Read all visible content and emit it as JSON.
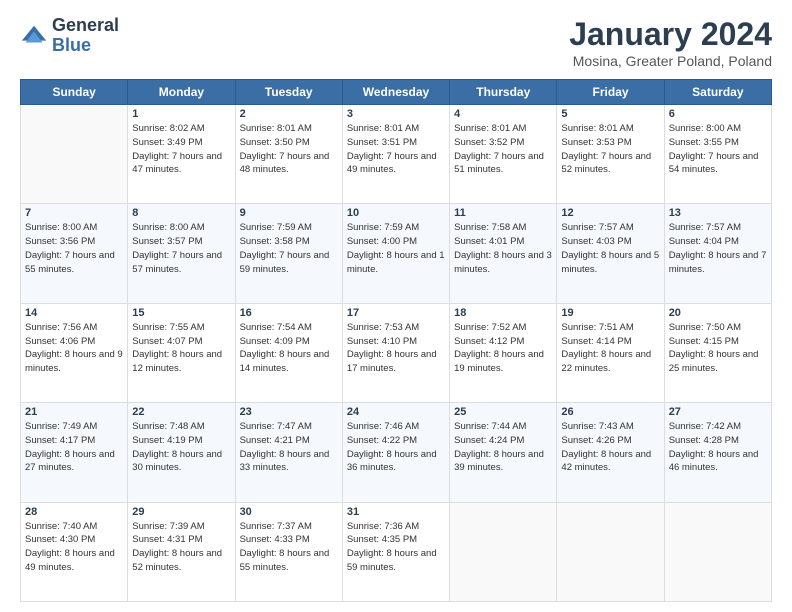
{
  "logo": {
    "general": "General",
    "blue": "Blue"
  },
  "title": "January 2024",
  "subtitle": "Mosina, Greater Poland, Poland",
  "weekdays": [
    "Sunday",
    "Monday",
    "Tuesday",
    "Wednesday",
    "Thursday",
    "Friday",
    "Saturday"
  ],
  "weeks": [
    [
      {
        "day": "",
        "sunrise": "",
        "sunset": "",
        "daylight": ""
      },
      {
        "day": "1",
        "sunrise": "Sunrise: 8:02 AM",
        "sunset": "Sunset: 3:49 PM",
        "daylight": "Daylight: 7 hours and 47 minutes."
      },
      {
        "day": "2",
        "sunrise": "Sunrise: 8:01 AM",
        "sunset": "Sunset: 3:50 PM",
        "daylight": "Daylight: 7 hours and 48 minutes."
      },
      {
        "day": "3",
        "sunrise": "Sunrise: 8:01 AM",
        "sunset": "Sunset: 3:51 PM",
        "daylight": "Daylight: 7 hours and 49 minutes."
      },
      {
        "day": "4",
        "sunrise": "Sunrise: 8:01 AM",
        "sunset": "Sunset: 3:52 PM",
        "daylight": "Daylight: 7 hours and 51 minutes."
      },
      {
        "day": "5",
        "sunrise": "Sunrise: 8:01 AM",
        "sunset": "Sunset: 3:53 PM",
        "daylight": "Daylight: 7 hours and 52 minutes."
      },
      {
        "day": "6",
        "sunrise": "Sunrise: 8:00 AM",
        "sunset": "Sunset: 3:55 PM",
        "daylight": "Daylight: 7 hours and 54 minutes."
      }
    ],
    [
      {
        "day": "7",
        "sunrise": "Sunrise: 8:00 AM",
        "sunset": "Sunset: 3:56 PM",
        "daylight": "Daylight: 7 hours and 55 minutes."
      },
      {
        "day": "8",
        "sunrise": "Sunrise: 8:00 AM",
        "sunset": "Sunset: 3:57 PM",
        "daylight": "Daylight: 7 hours and 57 minutes."
      },
      {
        "day": "9",
        "sunrise": "Sunrise: 7:59 AM",
        "sunset": "Sunset: 3:58 PM",
        "daylight": "Daylight: 7 hours and 59 minutes."
      },
      {
        "day": "10",
        "sunrise": "Sunrise: 7:59 AM",
        "sunset": "Sunset: 4:00 PM",
        "daylight": "Daylight: 8 hours and 1 minute."
      },
      {
        "day": "11",
        "sunrise": "Sunrise: 7:58 AM",
        "sunset": "Sunset: 4:01 PM",
        "daylight": "Daylight: 8 hours and 3 minutes."
      },
      {
        "day": "12",
        "sunrise": "Sunrise: 7:57 AM",
        "sunset": "Sunset: 4:03 PM",
        "daylight": "Daylight: 8 hours and 5 minutes."
      },
      {
        "day": "13",
        "sunrise": "Sunrise: 7:57 AM",
        "sunset": "Sunset: 4:04 PM",
        "daylight": "Daylight: 8 hours and 7 minutes."
      }
    ],
    [
      {
        "day": "14",
        "sunrise": "Sunrise: 7:56 AM",
        "sunset": "Sunset: 4:06 PM",
        "daylight": "Daylight: 8 hours and 9 minutes."
      },
      {
        "day": "15",
        "sunrise": "Sunrise: 7:55 AM",
        "sunset": "Sunset: 4:07 PM",
        "daylight": "Daylight: 8 hours and 12 minutes."
      },
      {
        "day": "16",
        "sunrise": "Sunrise: 7:54 AM",
        "sunset": "Sunset: 4:09 PM",
        "daylight": "Daylight: 8 hours and 14 minutes."
      },
      {
        "day": "17",
        "sunrise": "Sunrise: 7:53 AM",
        "sunset": "Sunset: 4:10 PM",
        "daylight": "Daylight: 8 hours and 17 minutes."
      },
      {
        "day": "18",
        "sunrise": "Sunrise: 7:52 AM",
        "sunset": "Sunset: 4:12 PM",
        "daylight": "Daylight: 8 hours and 19 minutes."
      },
      {
        "day": "19",
        "sunrise": "Sunrise: 7:51 AM",
        "sunset": "Sunset: 4:14 PM",
        "daylight": "Daylight: 8 hours and 22 minutes."
      },
      {
        "day": "20",
        "sunrise": "Sunrise: 7:50 AM",
        "sunset": "Sunset: 4:15 PM",
        "daylight": "Daylight: 8 hours and 25 minutes."
      }
    ],
    [
      {
        "day": "21",
        "sunrise": "Sunrise: 7:49 AM",
        "sunset": "Sunset: 4:17 PM",
        "daylight": "Daylight: 8 hours and 27 minutes."
      },
      {
        "day": "22",
        "sunrise": "Sunrise: 7:48 AM",
        "sunset": "Sunset: 4:19 PM",
        "daylight": "Daylight: 8 hours and 30 minutes."
      },
      {
        "day": "23",
        "sunrise": "Sunrise: 7:47 AM",
        "sunset": "Sunset: 4:21 PM",
        "daylight": "Daylight: 8 hours and 33 minutes."
      },
      {
        "day": "24",
        "sunrise": "Sunrise: 7:46 AM",
        "sunset": "Sunset: 4:22 PM",
        "daylight": "Daylight: 8 hours and 36 minutes."
      },
      {
        "day": "25",
        "sunrise": "Sunrise: 7:44 AM",
        "sunset": "Sunset: 4:24 PM",
        "daylight": "Daylight: 8 hours and 39 minutes."
      },
      {
        "day": "26",
        "sunrise": "Sunrise: 7:43 AM",
        "sunset": "Sunset: 4:26 PM",
        "daylight": "Daylight: 8 hours and 42 minutes."
      },
      {
        "day": "27",
        "sunrise": "Sunrise: 7:42 AM",
        "sunset": "Sunset: 4:28 PM",
        "daylight": "Daylight: 8 hours and 46 minutes."
      }
    ],
    [
      {
        "day": "28",
        "sunrise": "Sunrise: 7:40 AM",
        "sunset": "Sunset: 4:30 PM",
        "daylight": "Daylight: 8 hours and 49 minutes."
      },
      {
        "day": "29",
        "sunrise": "Sunrise: 7:39 AM",
        "sunset": "Sunset: 4:31 PM",
        "daylight": "Daylight: 8 hours and 52 minutes."
      },
      {
        "day": "30",
        "sunrise": "Sunrise: 7:37 AM",
        "sunset": "Sunset: 4:33 PM",
        "daylight": "Daylight: 8 hours and 55 minutes."
      },
      {
        "day": "31",
        "sunrise": "Sunrise: 7:36 AM",
        "sunset": "Sunset: 4:35 PM",
        "daylight": "Daylight: 8 hours and 59 minutes."
      },
      {
        "day": "",
        "sunrise": "",
        "sunset": "",
        "daylight": ""
      },
      {
        "day": "",
        "sunrise": "",
        "sunset": "",
        "daylight": ""
      },
      {
        "day": "",
        "sunrise": "",
        "sunset": "",
        "daylight": ""
      }
    ]
  ]
}
